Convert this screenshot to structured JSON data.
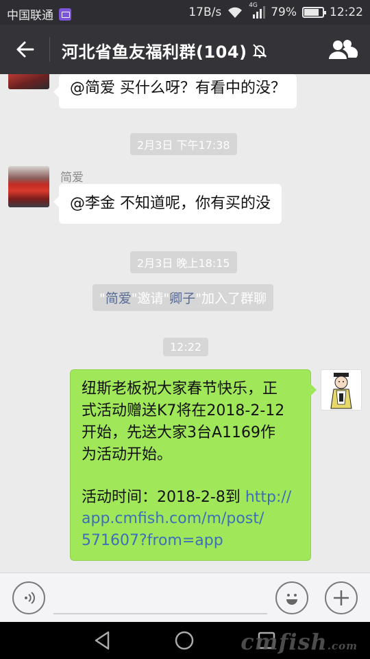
{
  "status": {
    "carrier": "中国联通",
    "speed": "17B/s",
    "network": "4G",
    "battery": "79%",
    "battery_level": 0.79,
    "time": "12:22",
    "icons": [
      "gallery-icon",
      "wifi-icon",
      "signal-icon",
      "battery-icon"
    ]
  },
  "header": {
    "title": "河北省鱼友福利群(104)",
    "icons": [
      "back-arrow-icon",
      "mute-bell-icon",
      "group-members-icon"
    ]
  },
  "messages": {
    "m1": {
      "text": "@简爱 买什么呀？有看中的没？"
    },
    "t1": "2月3日 下午17:38",
    "m2": {
      "sender": "简爱",
      "text": "@李金 不知道呢，你有买的没"
    },
    "t2": "2月3日 晚上18:15",
    "sys": {
      "q1": "\"",
      "inviter": "简爱",
      "q2": "\"邀请\"",
      "invitee": "卿子",
      "q3": "\"加入了群聊"
    },
    "t3": "12:22",
    "m3": {
      "line1": "纽斯老板祝大家春节快乐，正",
      "line2": "式活动赠送K7将在2018-2-12",
      "line3": "开始，先送大家3台A1169作",
      "line4": "为活动开始。",
      "line5_prefix": "活动时间：2018-2-8到 ",
      "link1": "http://",
      "link2": "app.cmfish.com/m/post/",
      "link3": "571607?from=app"
    }
  },
  "input": {
    "icons": [
      "voice-icon",
      "emoji-icon",
      "plus-icon"
    ]
  },
  "nav": {
    "icons": [
      "nav-back-icon",
      "nav-home-icon",
      "nav-recent-icon"
    ],
    "watermark": "cmfish",
    "watermark_suffix": ".com"
  },
  "colors": {
    "my_bubble": "#a0e75a",
    "link": "#3d6fb8",
    "name_highlight": "#576b95"
  }
}
